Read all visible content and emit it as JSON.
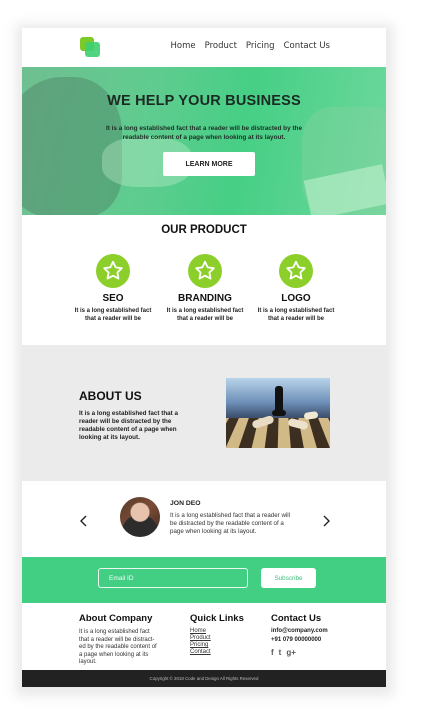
{
  "nav": {
    "items": [
      "Home",
      "Product",
      "Pricing",
      "Contact Us"
    ]
  },
  "hero": {
    "title": "WE HELP YOUR BUSINESS",
    "text": "It is a long established fact that a reader will be distracted by the readable content of a page when looking at its layout.",
    "button": "LEARN MORE"
  },
  "product": {
    "title": "OUR PRODUCT",
    "items": [
      {
        "icon": "star-icon",
        "title": "SEO",
        "text": "It is a long established fact that a reader will be distracted by the"
      },
      {
        "icon": "star-icon",
        "title": "BRANDING",
        "text": "It is a long established fact that a reader will be distracted by the"
      },
      {
        "icon": "star-icon",
        "title": "LOGO",
        "text": "It is a long established fact that a reader will be distracted by the"
      }
    ]
  },
  "about": {
    "title": "ABOUT US",
    "text": "It is a long established fact that a reader will be distracted by the readable content of a page when looking at its layout."
  },
  "testimonial": {
    "name": "JON DEO",
    "text": "It is a long established fact that a reader will be distracted by the readable content of a page when looking at its layout."
  },
  "subscribe": {
    "placeholder": "Email ID",
    "button": "Subscribe"
  },
  "footer": {
    "about_title": "About Company",
    "about_text": "It is a long established fact that a reader will be distract-ed by the readable content of a page when looking at its layout.",
    "links_title": "Quick Links",
    "links": [
      "Home",
      "Product",
      "Pricing",
      "Contact"
    ],
    "contact_title": "Contact Us",
    "email": "info@company.com",
    "phone": "+91 079 00000000",
    "social": [
      "f",
      "t",
      "g+"
    ],
    "copyright": "Copyright © 2018 Code and Design All Rights Reserved"
  },
  "colors": {
    "green": "#42cf84",
    "lime": "#8dcf2a",
    "dark": "#222222"
  }
}
